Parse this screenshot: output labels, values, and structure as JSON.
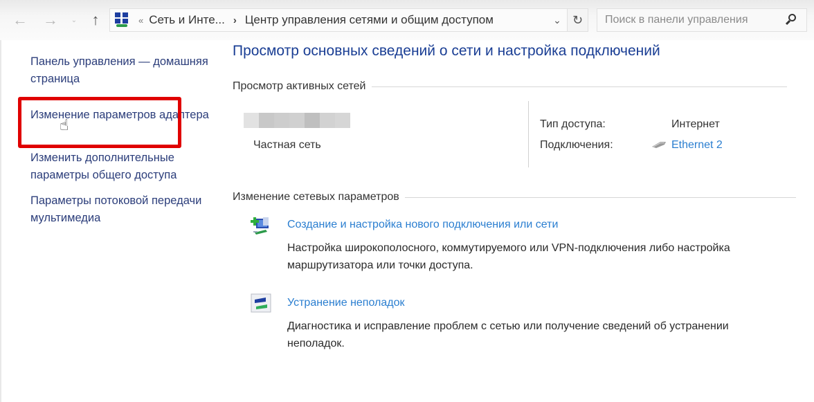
{
  "toolbar": {
    "back_icon": "arrow-left-icon",
    "forward_icon": "arrow-right-icon",
    "recent_icon": "chevron-down-icon",
    "up_icon": "arrow-up-icon",
    "back_glyph": "←",
    "forward_glyph": "→",
    "recent_glyph": "⌄",
    "up_glyph": "↑"
  },
  "address_bar": {
    "overflow_glyph": "«",
    "breadcrumbs": [
      "Сеть и Инте...",
      "Центр управления сетями и общим доступом"
    ],
    "separator_glyph": "›",
    "dropdown_glyph": "⌄",
    "refresh_glyph": "↻"
  },
  "search": {
    "placeholder": "Поиск в панели управления",
    "value": ""
  },
  "sidebar": {
    "items": [
      {
        "label": "Панель управления — домашняя страница"
      },
      {
        "label": "Изменение параметров адаптера",
        "highlighted": true
      },
      {
        "label": "Изменить дополнительные параметры общего доступа"
      },
      {
        "label": "Параметры потоковой передачи мультимедиа"
      }
    ],
    "cursor_glyph": "☝"
  },
  "main": {
    "title": "Просмотр основных сведений о сети и настройка подключений",
    "active_networks": {
      "heading": "Просмотр активных сетей",
      "network_name_redacted": true,
      "network_type": "Частная сеть",
      "access_type_label": "Тип доступа:",
      "access_type_value": "Интернет",
      "connections_label": "Подключения:",
      "connection_name": "Ethernet 2"
    },
    "change_settings": {
      "heading": "Изменение сетевых параметров",
      "tasks": [
        {
          "icon": "new-connection-icon",
          "title": "Создание и настройка нового подключения или сети",
          "description": "Настройка широкополосного, коммутируемого или VPN-подключения либо настройка маршрутизатора или точки доступа."
        },
        {
          "icon": "troubleshoot-icon",
          "title": "Устранение неполадок",
          "description": "Диагностика и исправление проблем с сетью или получение сведений об устранении неполадок."
        }
      ]
    }
  },
  "colors": {
    "title_blue": "#1a3e94",
    "link_blue": "#2a7ed0",
    "sidebar_link": "#2b3d7a",
    "highlight_red": "#e00000"
  }
}
